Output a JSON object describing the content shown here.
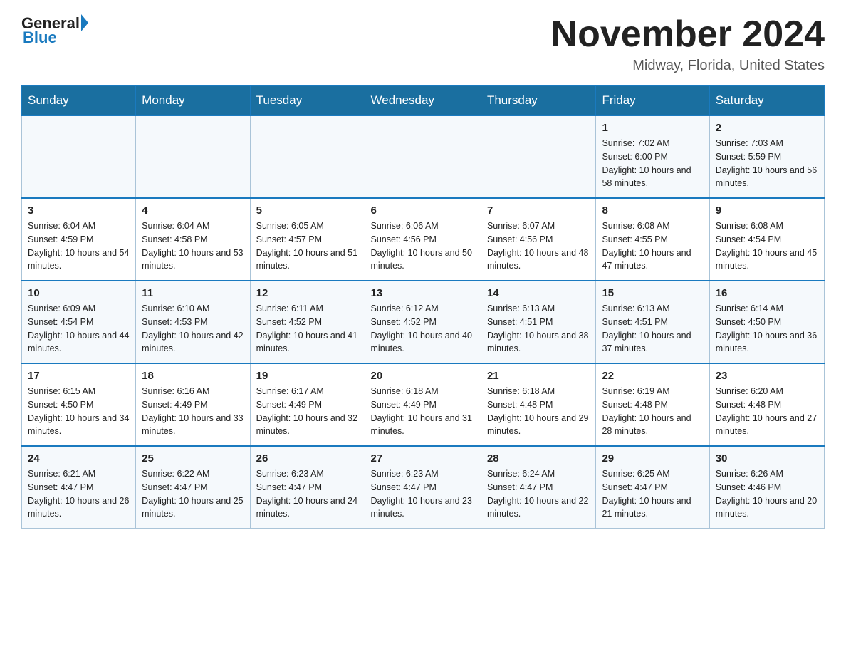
{
  "logo": {
    "general": "General",
    "blue": "Blue"
  },
  "header": {
    "month": "November 2024",
    "location": "Midway, Florida, United States"
  },
  "weekdays": [
    "Sunday",
    "Monday",
    "Tuesday",
    "Wednesday",
    "Thursday",
    "Friday",
    "Saturday"
  ],
  "weeks": [
    [
      {
        "day": "",
        "info": ""
      },
      {
        "day": "",
        "info": ""
      },
      {
        "day": "",
        "info": ""
      },
      {
        "day": "",
        "info": ""
      },
      {
        "day": "",
        "info": ""
      },
      {
        "day": "1",
        "info": "Sunrise: 7:02 AM\nSunset: 6:00 PM\nDaylight: 10 hours and 58 minutes."
      },
      {
        "day": "2",
        "info": "Sunrise: 7:03 AM\nSunset: 5:59 PM\nDaylight: 10 hours and 56 minutes."
      }
    ],
    [
      {
        "day": "3",
        "info": "Sunrise: 6:04 AM\nSunset: 4:59 PM\nDaylight: 10 hours and 54 minutes."
      },
      {
        "day": "4",
        "info": "Sunrise: 6:04 AM\nSunset: 4:58 PM\nDaylight: 10 hours and 53 minutes."
      },
      {
        "day": "5",
        "info": "Sunrise: 6:05 AM\nSunset: 4:57 PM\nDaylight: 10 hours and 51 minutes."
      },
      {
        "day": "6",
        "info": "Sunrise: 6:06 AM\nSunset: 4:56 PM\nDaylight: 10 hours and 50 minutes."
      },
      {
        "day": "7",
        "info": "Sunrise: 6:07 AM\nSunset: 4:56 PM\nDaylight: 10 hours and 48 minutes."
      },
      {
        "day": "8",
        "info": "Sunrise: 6:08 AM\nSunset: 4:55 PM\nDaylight: 10 hours and 47 minutes."
      },
      {
        "day": "9",
        "info": "Sunrise: 6:08 AM\nSunset: 4:54 PM\nDaylight: 10 hours and 45 minutes."
      }
    ],
    [
      {
        "day": "10",
        "info": "Sunrise: 6:09 AM\nSunset: 4:54 PM\nDaylight: 10 hours and 44 minutes."
      },
      {
        "day": "11",
        "info": "Sunrise: 6:10 AM\nSunset: 4:53 PM\nDaylight: 10 hours and 42 minutes."
      },
      {
        "day": "12",
        "info": "Sunrise: 6:11 AM\nSunset: 4:52 PM\nDaylight: 10 hours and 41 minutes."
      },
      {
        "day": "13",
        "info": "Sunrise: 6:12 AM\nSunset: 4:52 PM\nDaylight: 10 hours and 40 minutes."
      },
      {
        "day": "14",
        "info": "Sunrise: 6:13 AM\nSunset: 4:51 PM\nDaylight: 10 hours and 38 minutes."
      },
      {
        "day": "15",
        "info": "Sunrise: 6:13 AM\nSunset: 4:51 PM\nDaylight: 10 hours and 37 minutes."
      },
      {
        "day": "16",
        "info": "Sunrise: 6:14 AM\nSunset: 4:50 PM\nDaylight: 10 hours and 36 minutes."
      }
    ],
    [
      {
        "day": "17",
        "info": "Sunrise: 6:15 AM\nSunset: 4:50 PM\nDaylight: 10 hours and 34 minutes."
      },
      {
        "day": "18",
        "info": "Sunrise: 6:16 AM\nSunset: 4:49 PM\nDaylight: 10 hours and 33 minutes."
      },
      {
        "day": "19",
        "info": "Sunrise: 6:17 AM\nSunset: 4:49 PM\nDaylight: 10 hours and 32 minutes."
      },
      {
        "day": "20",
        "info": "Sunrise: 6:18 AM\nSunset: 4:49 PM\nDaylight: 10 hours and 31 minutes."
      },
      {
        "day": "21",
        "info": "Sunrise: 6:18 AM\nSunset: 4:48 PM\nDaylight: 10 hours and 29 minutes."
      },
      {
        "day": "22",
        "info": "Sunrise: 6:19 AM\nSunset: 4:48 PM\nDaylight: 10 hours and 28 minutes."
      },
      {
        "day": "23",
        "info": "Sunrise: 6:20 AM\nSunset: 4:48 PM\nDaylight: 10 hours and 27 minutes."
      }
    ],
    [
      {
        "day": "24",
        "info": "Sunrise: 6:21 AM\nSunset: 4:47 PM\nDaylight: 10 hours and 26 minutes."
      },
      {
        "day": "25",
        "info": "Sunrise: 6:22 AM\nSunset: 4:47 PM\nDaylight: 10 hours and 25 minutes."
      },
      {
        "day": "26",
        "info": "Sunrise: 6:23 AM\nSunset: 4:47 PM\nDaylight: 10 hours and 24 minutes."
      },
      {
        "day": "27",
        "info": "Sunrise: 6:23 AM\nSunset: 4:47 PM\nDaylight: 10 hours and 23 minutes."
      },
      {
        "day": "28",
        "info": "Sunrise: 6:24 AM\nSunset: 4:47 PM\nDaylight: 10 hours and 22 minutes."
      },
      {
        "day": "29",
        "info": "Sunrise: 6:25 AM\nSunset: 4:47 PM\nDaylight: 10 hours and 21 minutes."
      },
      {
        "day": "30",
        "info": "Sunrise: 6:26 AM\nSunset: 4:46 PM\nDaylight: 10 hours and 20 minutes."
      }
    ]
  ]
}
